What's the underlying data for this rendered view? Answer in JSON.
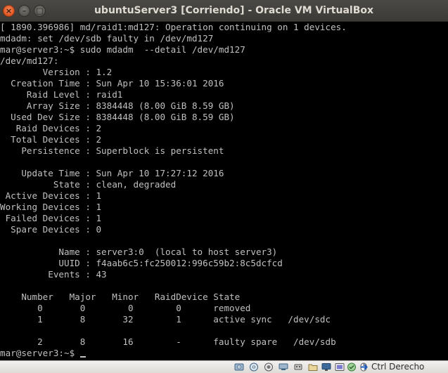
{
  "window": {
    "title": "ubuntuServer3 [Corriendo] - Oracle VM VirtualBox",
    "close_glyph": "×",
    "minimize_glyph": "–",
    "maximize_glyph": "□"
  },
  "console": {
    "lines": [
      "[ 1890.396986] md/raid1:md127: Operation continuing on 1 devices.",
      "mdadm: set /dev/sdb faulty in /dev/md127",
      "mar@server3:~$ sudo mdadm  --detail /dev/md127",
      "/dev/md127:",
      "        Version : 1.2",
      "  Creation Time : Sun Apr 10 15:36:01 2016",
      "     Raid Level : raid1",
      "     Array Size : 8384448 (8.00 GiB 8.59 GB)",
      "  Used Dev Size : 8384448 (8.00 GiB 8.59 GB)",
      "   Raid Devices : 2",
      "  Total Devices : 2",
      "    Persistence : Superblock is persistent",
      "",
      "    Update Time : Sun Apr 10 17:27:12 2016",
      "          State : clean, degraded",
      " Active Devices : 1",
      "Working Devices : 1",
      " Failed Devices : 1",
      "  Spare Devices : 0",
      "",
      "           Name : server3:0  (local to host server3)",
      "           UUID : f4aab6c5:fc250012:996c59b2:8c5dcfcd",
      "         Events : 43",
      "",
      "    Number   Major   Minor   RaidDevice State",
      "       0       0        0        0      removed",
      "       1       8       32        1      active sync   /dev/sdc",
      "",
      "       2       8       16        -      faulty spare   /dev/sdb",
      "mar@server3:~$ "
    ]
  },
  "statusbar": {
    "icons": [
      "hard-disk-icon",
      "optical-disk-icon",
      "audio-icon",
      "network-icon",
      "usb-icon",
      "shared-folders-icon",
      "display-icon",
      "video-capture-icon",
      "virtualization-icon",
      "mouse-integration-icon",
      "host-key-arrow-icon"
    ],
    "host_key_label": "Ctrl Derecho"
  },
  "colors": {
    "titlebar": "#3c3b37",
    "title_text": "#dfdbd2",
    "console_bg": "#000000",
    "console_text": "#c0c0c0",
    "close_button": "#e95420",
    "statusbar_bg": "#edebe9"
  }
}
